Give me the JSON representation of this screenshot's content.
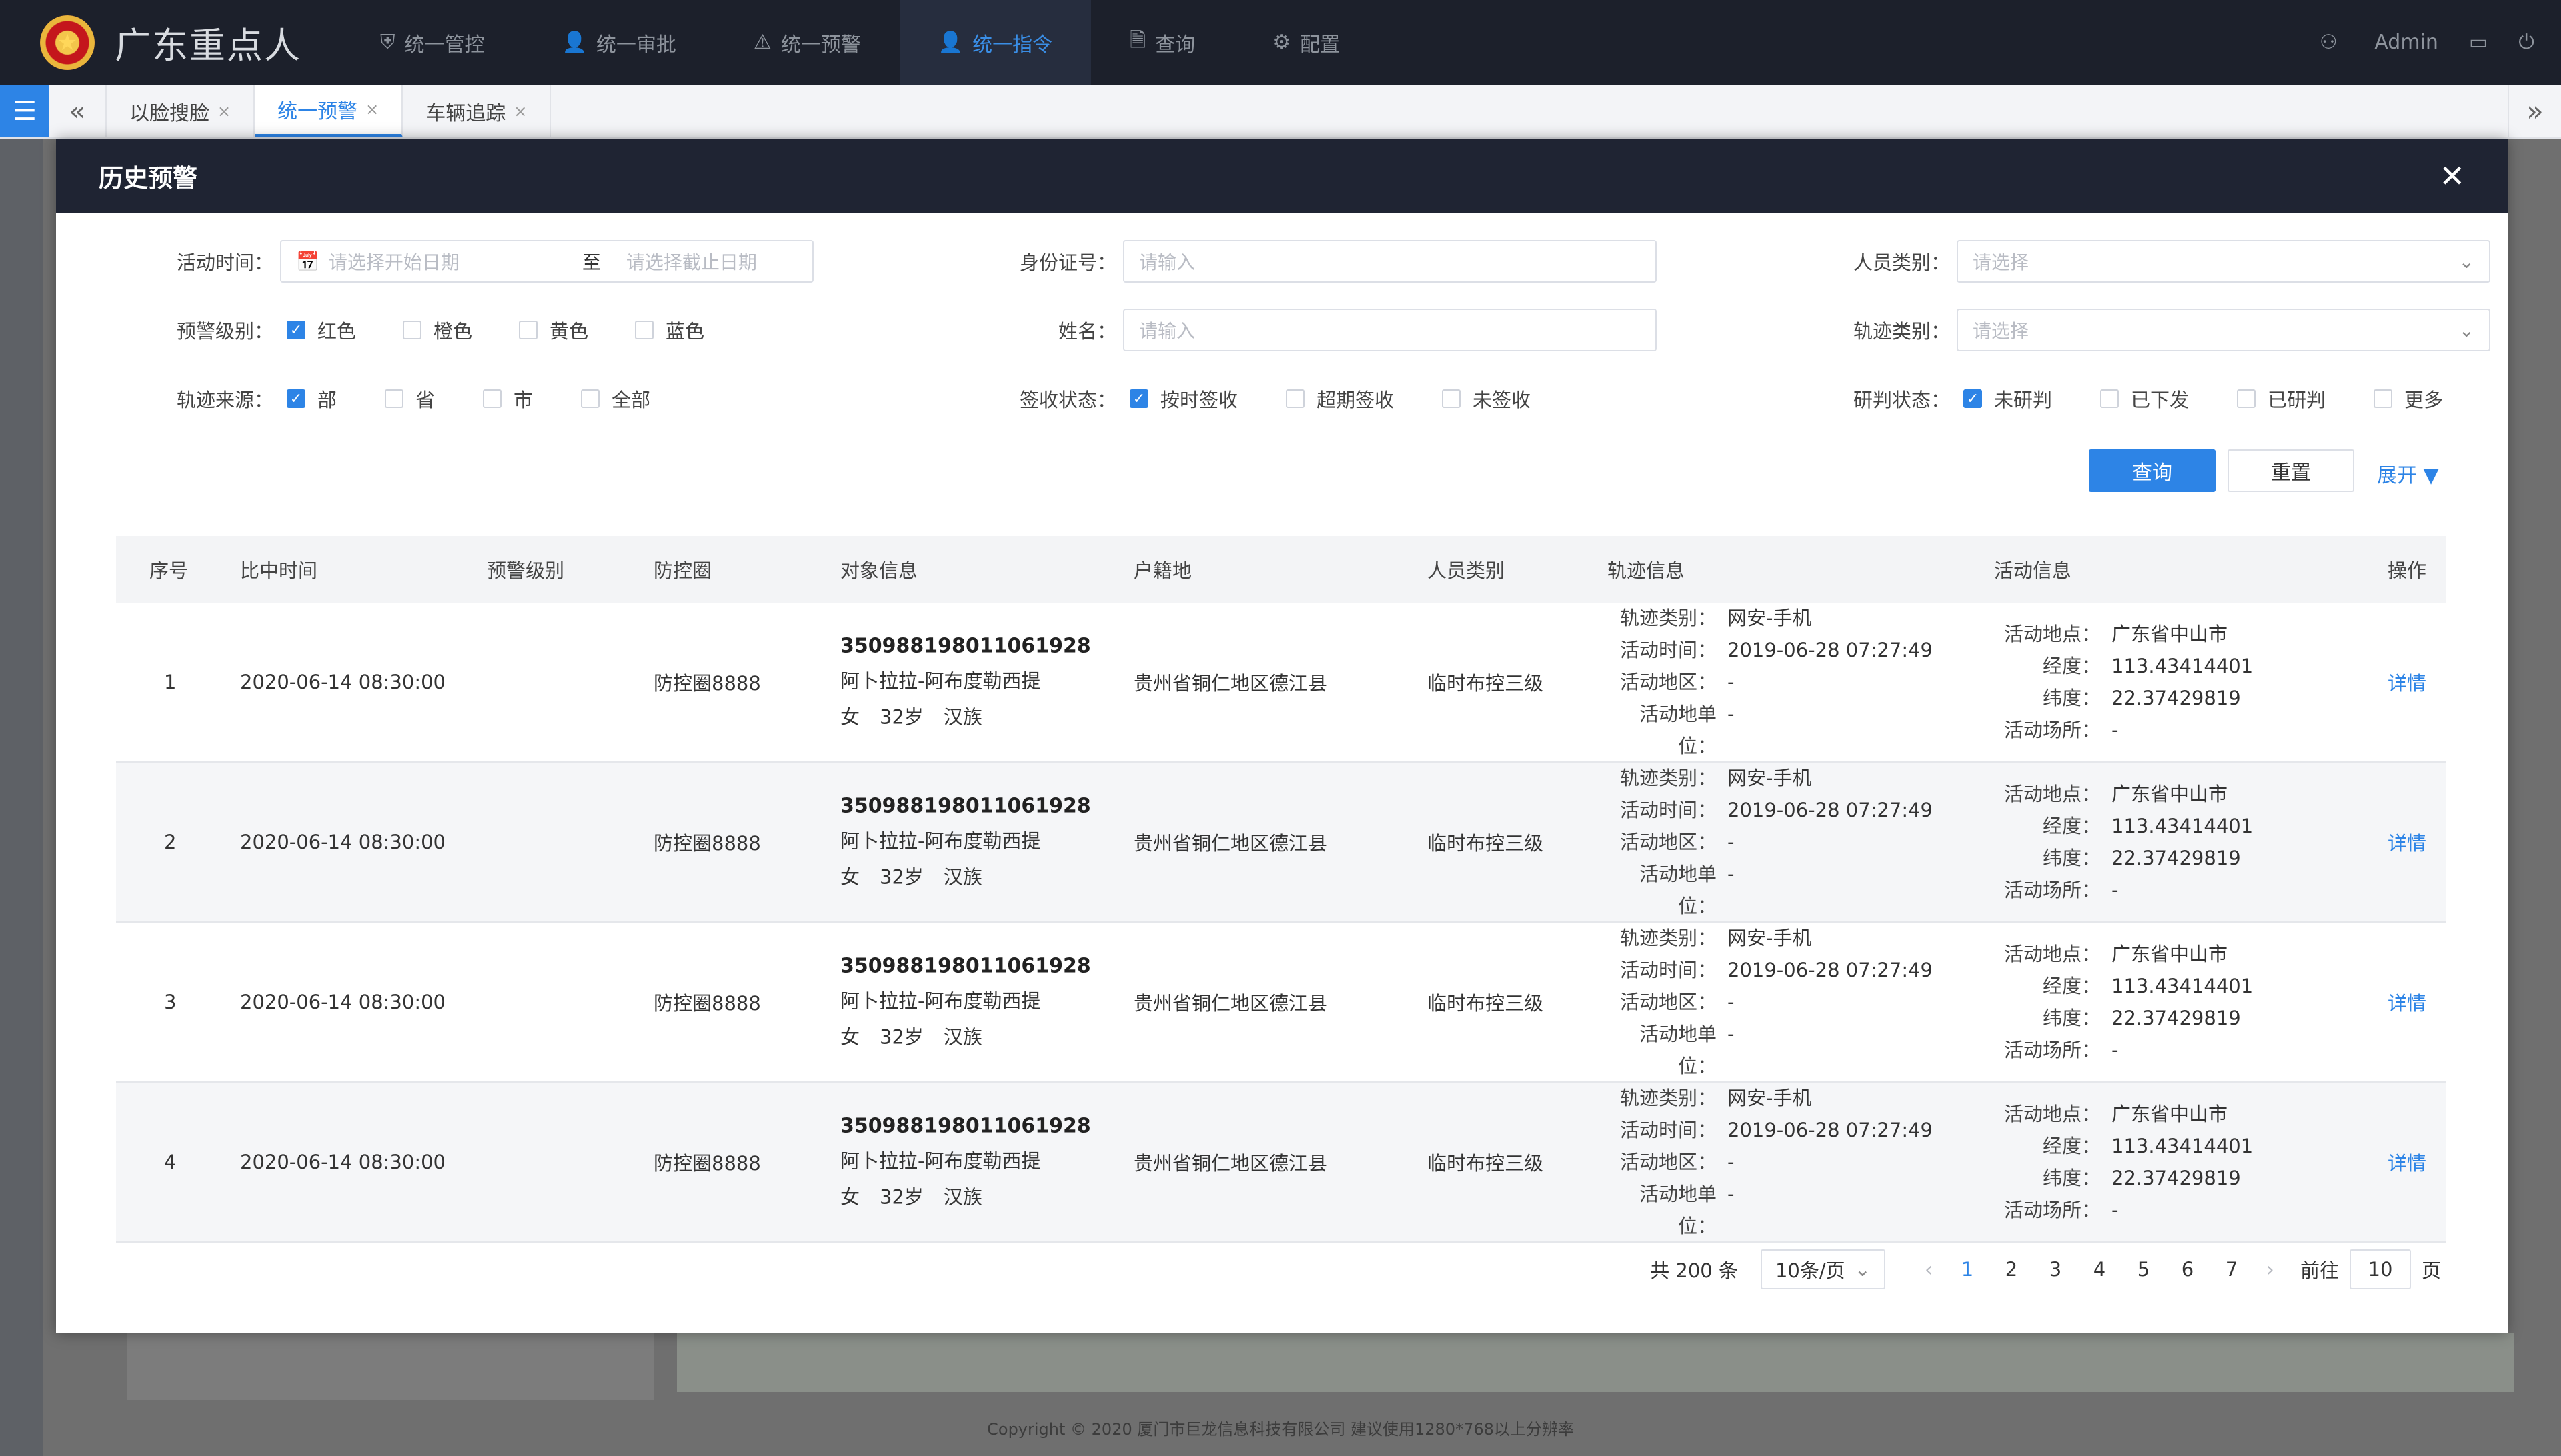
{
  "app": {
    "title": "广东重点人",
    "logo_glyph": "★"
  },
  "nav": [
    {
      "label": "统一管控",
      "icon": "shield-icon",
      "glyph": "⛨"
    },
    {
      "label": "统一审批",
      "icon": "user-icon",
      "glyph": "👤"
    },
    {
      "label": "统一预警",
      "icon": "alarm-icon",
      "glyph": "⚠"
    },
    {
      "label": "统一指令",
      "icon": "user-icon",
      "glyph": "👤"
    },
    {
      "label": "查询",
      "icon": "document-icon",
      "glyph": "🗎"
    },
    {
      "label": "配置",
      "icon": "gear-icon",
      "glyph": "⚙"
    }
  ],
  "user": {
    "name": "Admin"
  },
  "tabs": [
    {
      "label": "以脸搜脸"
    },
    {
      "label": "统一预警"
    },
    {
      "label": "车辆追踪"
    }
  ],
  "tab_close": "×",
  "modal": {
    "title": "历史预警",
    "close": "✕"
  },
  "filters": {
    "activity_time_label": "活动时间：",
    "start_placeholder": "请选择开始日期",
    "to": "至",
    "end_placeholder": "请选择截止日期",
    "id_label": "身份证号：",
    "id_placeholder": "请输入",
    "person_type_label": "人员类别：",
    "person_type_placeholder": "请选择",
    "level_label": "预警级别：",
    "level_options": [
      {
        "label": "红色",
        "checked": true
      },
      {
        "label": "橙色",
        "checked": false
      },
      {
        "label": "黄色",
        "checked": false
      },
      {
        "label": "蓝色",
        "checked": false
      }
    ],
    "name_label": "姓名：",
    "name_placeholder": "请输入",
    "track_type_label": "轨迹类别：",
    "track_type_placeholder": "请选择",
    "source_label": "轨迹来源：",
    "source_options": [
      {
        "label": "部",
        "checked": true
      },
      {
        "label": "省",
        "checked": false
      },
      {
        "label": "市",
        "checked": false
      },
      {
        "label": "全部",
        "checked": false
      }
    ],
    "sign_label": "签收状态：",
    "sign_options": [
      {
        "label": "按时签收",
        "checked": true
      },
      {
        "label": "超期签收",
        "checked": false
      },
      {
        "label": "未签收",
        "checked": false
      }
    ],
    "judge_label": "研判状态：",
    "judge_options": [
      {
        "label": "未研判",
        "checked": true
      },
      {
        "label": "已下发",
        "checked": false
      },
      {
        "label": "已研判",
        "checked": false
      },
      {
        "label": "更多",
        "checked": false
      }
    ],
    "query_button": "查询",
    "reset_button": "重置",
    "expand_link": "展开 ▼"
  },
  "table": {
    "headers": [
      "序号",
      "比中时间",
      "预警级别",
      "防控圈",
      "对象信息",
      "户籍地",
      "人员类别",
      "轨迹信息",
      "活动信息",
      "操作"
    ],
    "track_keys": [
      "轨迹类别：",
      "活动时间：",
      "活动地区：",
      "活动地单位："
    ],
    "activity_keys": [
      "活动地点：",
      "经度：",
      "纬度：",
      "活动场所："
    ],
    "rows": [
      {
        "no": "1",
        "time": "2020-06-14 08:30:00",
        "level": "",
        "circle": "防控圈8888",
        "id": "350988198011061928",
        "name": "阿卜拉拉-阿布度勒西提",
        "gender": "女",
        "age": "32岁",
        "ethnic": "汉族",
        "hukou": "贵州省铜仁地区德江县",
        "ptype": "临时布控三级",
        "track": [
          "网安-手机",
          "2019-06-28 07:27:49",
          "-",
          "-"
        ],
        "activity": [
          "广东省中山市",
          "113.43414401",
          "22.37429819",
          "-"
        ],
        "action": "详情"
      },
      {
        "no": "2",
        "time": "2020-06-14 08:30:00",
        "level": "",
        "circle": "防控圈8888",
        "id": "350988198011061928",
        "name": "阿卜拉拉-阿布度勒西提",
        "gender": "女",
        "age": "32岁",
        "ethnic": "汉族",
        "hukou": "贵州省铜仁地区德江县",
        "ptype": "临时布控三级",
        "track": [
          "网安-手机",
          "2019-06-28 07:27:49",
          "-",
          "-"
        ],
        "activity": [
          "广东省中山市",
          "113.43414401",
          "22.37429819",
          "-"
        ],
        "action": "详情"
      },
      {
        "no": "3",
        "time": "2020-06-14 08:30:00",
        "level": "",
        "circle": "防控圈8888",
        "id": "350988198011061928",
        "name": "阿卜拉拉-阿布度勒西提",
        "gender": "女",
        "age": "32岁",
        "ethnic": "汉族",
        "hukou": "贵州省铜仁地区德江县",
        "ptype": "临时布控三级",
        "track": [
          "网安-手机",
          "2019-06-28 07:27:49",
          "-",
          "-"
        ],
        "activity": [
          "广东省中山市",
          "113.43414401",
          "22.37429819",
          "-"
        ],
        "action": "详情"
      },
      {
        "no": "4",
        "time": "2020-06-14 08:30:00",
        "level": "",
        "circle": "防控圈8888",
        "id": "350988198011061928",
        "name": "阿卜拉拉-阿布度勒西提",
        "gender": "女",
        "age": "32岁",
        "ethnic": "汉族",
        "hukou": "贵州省铜仁地区德江县",
        "ptype": "临时布控三级",
        "track": [
          "网安-手机",
          "2019-06-28 07:27:49",
          "-",
          "-"
        ],
        "activity": [
          "广东省中山市",
          "113.43414401",
          "22.37429819",
          "-"
        ],
        "action": "详情"
      }
    ]
  },
  "pagination": {
    "total": "共 200 条",
    "page_size": "10条/页",
    "pages": [
      "1",
      "2",
      "3",
      "4",
      "5",
      "6",
      "7"
    ],
    "current": "1",
    "goto_label": "前往",
    "goto_value": "10",
    "page_suffix": "页"
  },
  "footer": {
    "copyright": "Copyright © 2020  厦门市巨龙信息科技有限公司  建议使用1280*768以上分辨率"
  },
  "colors": {
    "accent": "#2d84e6",
    "topbar": "#1c202b",
    "modal_header": "#1f2433"
  }
}
